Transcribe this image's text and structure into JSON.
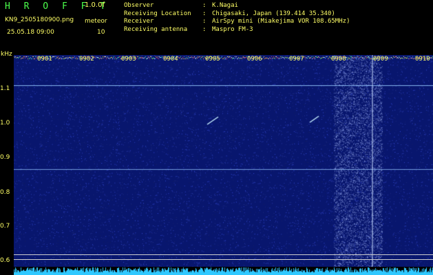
{
  "header": {
    "title": "H R O F F T",
    "version": "1.0.0f",
    "filename": "KN9_2505180900.png",
    "meteor_label": "meteor",
    "datetime": "25.05.18 09:00",
    "meteor_value": "10"
  },
  "info": [
    {
      "key": "Observer",
      "sep": ":",
      "value": "K.Nagai"
    },
    {
      "key": "Receiving Location",
      "sep": ":",
      "value": "Chigasaki, Japan (139.414 35.340)"
    },
    {
      "key": "Receiver",
      "sep": ":",
      "value": "AirSpy mini (Miakejima VOR 108.65MHz)"
    },
    {
      "key": "Receiving antenna",
      "sep": ":",
      "value": "Maspro FM-3"
    }
  ],
  "axis": {
    "unit_label": "kHz",
    "y_ticks": [
      "1.1",
      "1.0",
      "0.9",
      "0.8",
      "0.7",
      "0.6"
    ],
    "x_ticks": [
      "0901",
      "0902",
      "0903",
      "0904",
      "0905",
      "0906",
      "0907",
      "0908",
      "0909",
      "0910"
    ]
  },
  "colors": {
    "text": "#ffff66",
    "title": "#4cff4c",
    "background": "#000000",
    "plot_bg": "#0a1a7a"
  }
}
